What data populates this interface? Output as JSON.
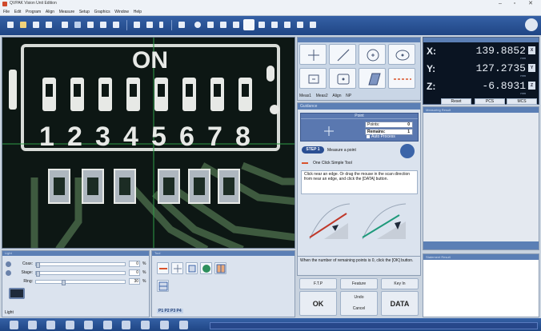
{
  "window": {
    "title": "QVPAK Vision Unit Edition"
  },
  "menu": [
    "File",
    "Edit",
    "Program",
    "Align",
    "Measure",
    "Setup",
    "Graphics",
    "Window",
    "Help"
  ],
  "camera": {
    "label": "",
    "switch_text": "ON",
    "digits": [
      "1",
      "2",
      "3",
      "4",
      "5",
      "6",
      "7",
      "8"
    ]
  },
  "measure_tools": {
    "tabs": [
      "Meas1",
      "Meas2",
      "Align",
      "NP"
    ],
    "tool_icons": [
      "crosshair-point-icon",
      "line-icon",
      "circle-icon",
      "circle-center-icon",
      "box-point-icon",
      "box-circle-icon",
      "parallelogram-icon",
      "dashed-line-icon"
    ]
  },
  "dro": {
    "axes": [
      {
        "axis": "X:",
        "value": "139.8852",
        "unit": "mm",
        "zero": "X"
      },
      {
        "axis": "Y:",
        "value": "127.2735",
        "unit": "mm",
        "zero": "Y"
      },
      {
        "axis": "Z:",
        "value": "-6.8931",
        "unit": "mm",
        "zero": "Z"
      }
    ],
    "buttons": [
      "Reset",
      "PCS",
      "MCS"
    ]
  },
  "guide": {
    "header": "Guidance",
    "point_title": "Point",
    "points_label": "Points:",
    "points_value": "0",
    "remains_label": "Remains:",
    "remains_value": "1",
    "auto_process": "Auto Process",
    "step_badge": "STEP 1",
    "step_text": "Measure a point",
    "tool_label": "One Click Simple Tool",
    "instruction": "Click near an edge. Or drag the mouse in the scan direction from near an edge, and click the [DATA] button.",
    "bottom_instruction": "When the number of remaining points is 0, click the [OK] button."
  },
  "action_buttons": {
    "ftp": "F.T.P",
    "feature": "Feature",
    "key_in": "Key In",
    "ok": "OK",
    "undo": "Undo",
    "cancel": "Cancel",
    "data": "DATA"
  },
  "side_panels": {
    "upper_title": "Measuring Result",
    "lower_title": "Statement Result"
  },
  "light": {
    "header": "Light",
    "rows": [
      {
        "name": "Coax:",
        "value": "0",
        "level": 0
      },
      {
        "name": "Stage:",
        "value": "0",
        "level": 0
      },
      {
        "name": "Ring:",
        "value": "30",
        "level": 30
      }
    ],
    "pct": "%",
    "label": "Light"
  },
  "tools_panel": {
    "header": "Tool",
    "page_tabs": "P1 P2 P3 P4"
  },
  "colors": {
    "accent": "#3561a6",
    "pcb": "#0f1a16",
    "trace": "#3e5a3f"
  }
}
